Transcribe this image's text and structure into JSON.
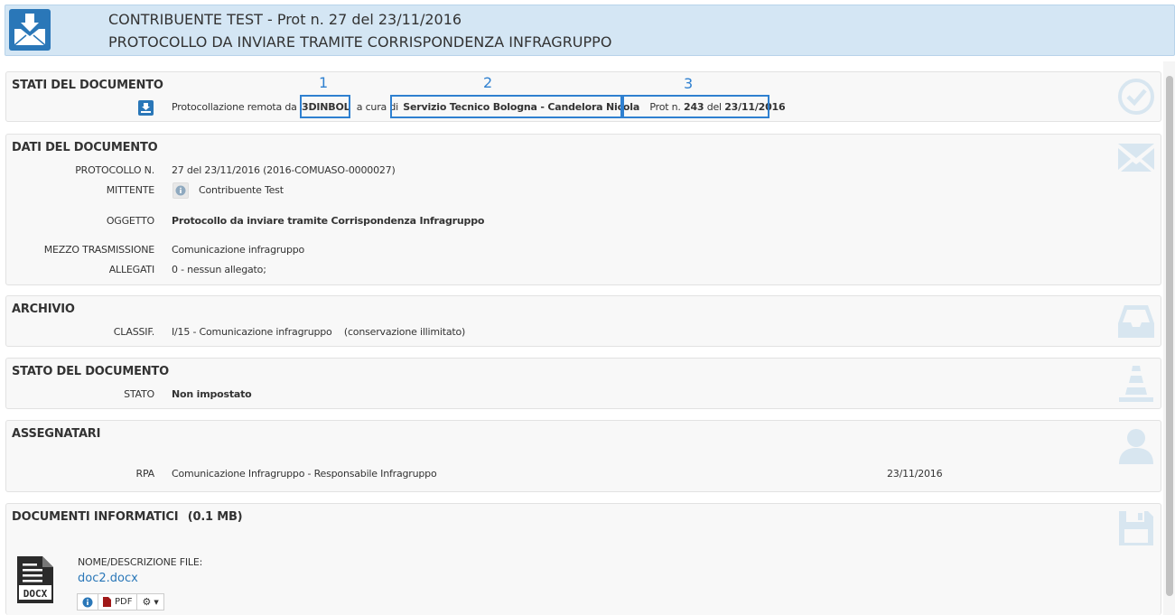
{
  "header": {
    "title": "CONTRIBUENTE TEST - Prot n. 27 del 23/11/2016",
    "subtitle": "PROTOCOLLO DA INVIARE TRAMITE CORRISPONDENZA INFRAGRUPPO"
  },
  "stati": {
    "title": "STATI DEL DOCUMENTO",
    "prefix": "Protocollazione remota da",
    "ente": "3DINBOL",
    "mid": "a cura di",
    "servizio": "Servizio Tecnico Bologna - Candelora Nicola",
    "prot_prefix": "Prot n.",
    "prot_num": "243",
    "prot_del": "del",
    "prot_date": "23/11/2016",
    "markers": [
      "1",
      "2",
      "3"
    ]
  },
  "dati": {
    "title": "DATI DEL DOCUMENTO",
    "protocollo_label": "PROTOCOLLO N.",
    "protocollo_value": "27 del 23/11/2016 (2016-COMUASO-0000027)",
    "mittente_label": "MITTENTE",
    "mittente_value": "Contribuente Test",
    "oggetto_label": "OGGETTO",
    "oggetto_value": "Protocollo da inviare tramite Corrispondenza Infragruppo",
    "mezzo_label": "MEZZO TRASMISSIONE",
    "mezzo_value": "Comunicazione infragruppo",
    "allegati_label": "ALLEGATI",
    "allegati_value": "0 - nessun allegato;"
  },
  "archivio": {
    "title": "ARCHIVIO",
    "classif_label": "CLASSIF.",
    "classif_value": "I/15 - Comunicazione infragruppo",
    "conservazione": "(conservazione illimitato)"
  },
  "stato": {
    "title": "STATO DEL DOCUMENTO",
    "stato_label": "STATO",
    "stato_value": "Non impostato"
  },
  "assegnatari": {
    "title": "ASSEGNATARI",
    "rpa_label": "RPA",
    "rpa_value": "Comunicazione Infragruppo - Responsabile Infragruppo",
    "rpa_date": "23/11/2016"
  },
  "documenti": {
    "title": "DOCUMENTI INFORMATICI",
    "size": "(0.1 MB)",
    "file_label": "NOME/DESCRIZIONE FILE:",
    "file_name": "doc2.docx",
    "pdf_label": "PDF",
    "file_type": "DOCX"
  },
  "colors": {
    "accent": "#2a77b8",
    "header_bg": "#d4e6f4",
    "highlight": "#2f80d0",
    "deco_icon": "#d8e6f0"
  }
}
